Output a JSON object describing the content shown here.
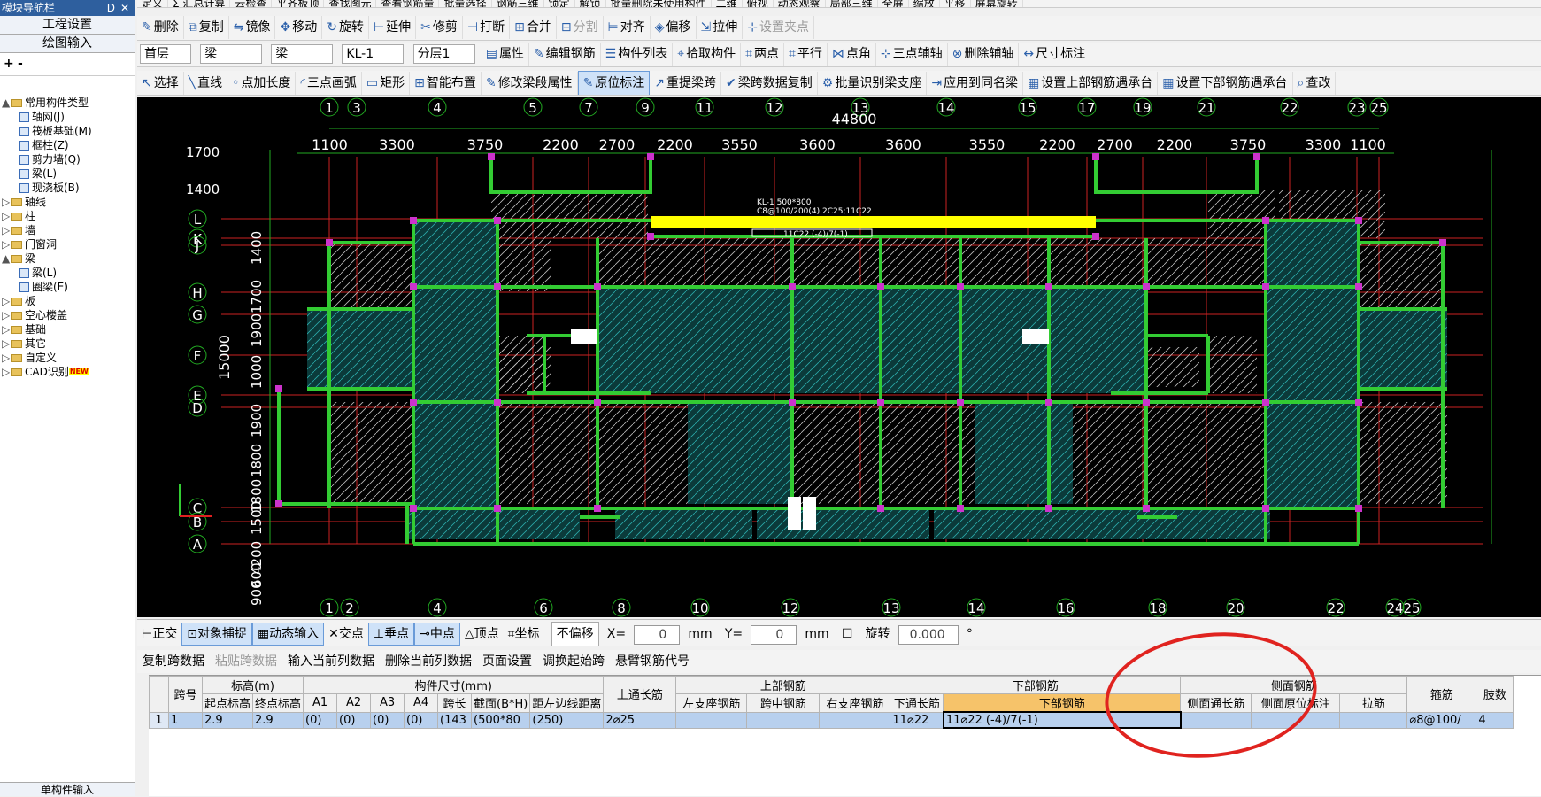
{
  "left_panel": {
    "title": "模块导航栏",
    "pin": "ᗞ",
    "close": "✕",
    "btn_project": "工程设置",
    "btn_draw": "绘图输入",
    "expand": "+",
    "collapse": "-",
    "tree": [
      {
        "label": "常用构件类型",
        "level": 0,
        "toggle": "▲"
      },
      {
        "label": "轴网(J)",
        "level": 1
      },
      {
        "label": "筏板基础(M)",
        "level": 1
      },
      {
        "label": "框柱(Z)",
        "level": 1
      },
      {
        "label": "剪力墙(Q)",
        "level": 1
      },
      {
        "label": "梁(L)",
        "level": 1
      },
      {
        "label": "现浇板(B)",
        "level": 1
      },
      {
        "label": "轴线",
        "level": 0,
        "toggle": "▷"
      },
      {
        "label": "柱",
        "level": 0,
        "toggle": "▷"
      },
      {
        "label": "墙",
        "level": 0,
        "toggle": "▷"
      },
      {
        "label": "门窗洞",
        "level": 0,
        "toggle": "▷"
      },
      {
        "label": "梁",
        "level": 0,
        "toggle": "▲"
      },
      {
        "label": "梁(L)",
        "level": 1
      },
      {
        "label": "圈梁(E)",
        "level": 1
      },
      {
        "label": "板",
        "level": 0,
        "toggle": "▷"
      },
      {
        "label": "空心楼盖",
        "level": 0,
        "toggle": "▷"
      },
      {
        "label": "基础",
        "level": 0,
        "toggle": "▷"
      },
      {
        "label": "其它",
        "level": 0,
        "toggle": "▷"
      },
      {
        "label": "自定义",
        "level": 0,
        "toggle": "▷"
      },
      {
        "label": "CAD识别",
        "level": 0,
        "toggle": "▷",
        "badge": "NEW"
      }
    ],
    "bottom": "单构件输入"
  },
  "toolbar_top": [
    "定义",
    "Σ 汇总计算",
    "云检查",
    "平齐板顶",
    "查找图元",
    "查看钢筋量",
    "批量选择",
    "钢筋三维",
    "锁定",
    "解锁",
    "批量删除未使用构件",
    "二维",
    "俯视",
    "动态观察",
    "局部三维",
    "全屏",
    "缩放",
    "平移",
    "屏幕旋转"
  ],
  "toolbar_edit": [
    {
      "g": "✎",
      "t": "删除"
    },
    {
      "g": "⧉",
      "t": "复制"
    },
    {
      "g": "⇋",
      "t": "镜像"
    },
    {
      "g": "✥",
      "t": "移动"
    },
    {
      "g": "↻",
      "t": "旋转"
    },
    {
      "g": "⊢",
      "t": "延伸"
    },
    {
      "g": "✂",
      "t": "修剪"
    },
    {
      "g": "⊣",
      "t": "打断"
    },
    {
      "g": "⊞",
      "t": "合并"
    },
    {
      "g": "⊟",
      "t": "分割",
      "dim": true
    },
    {
      "g": "⊨",
      "t": "对齐"
    },
    {
      "g": "◈",
      "t": "偏移"
    },
    {
      "g": "⇲",
      "t": "拉伸"
    },
    {
      "g": "⊹",
      "t": "设置夹点",
      "dim": true
    }
  ],
  "toolbar_component": {
    "floor": "首层",
    "type": "梁",
    "subtype": "梁",
    "name": "KL-1",
    "layer": "分层1",
    "items": [
      {
        "g": "▤",
        "t": "属性"
      },
      {
        "g": "✎",
        "t": "编辑钢筋"
      },
      {
        "g": "☰",
        "t": "构件列表"
      },
      {
        "g": "⌖",
        "t": "拾取构件"
      },
      {
        "g": "⌗",
        "t": "两点"
      },
      {
        "g": "⌗",
        "t": "平行"
      },
      {
        "g": "⋈",
        "t": "点角"
      },
      {
        "g": "⊹",
        "t": "三点辅轴"
      },
      {
        "g": "⊗",
        "t": "删除辅轴"
      },
      {
        "g": "↔",
        "t": "尺寸标注"
      }
    ]
  },
  "toolbar_draw": [
    {
      "g": "↖",
      "t": "选择"
    },
    {
      "g": "╲",
      "t": "直线"
    },
    {
      "g": "◦",
      "t": "点加长度"
    },
    {
      "g": "◜",
      "t": "三点画弧"
    },
    {
      "g": "▭",
      "t": "矩形"
    },
    {
      "g": "⊞",
      "t": "智能布置"
    },
    {
      "g": "✎",
      "t": "修改梁段属性"
    },
    {
      "g": "✎",
      "t": "原位标注",
      "active": true
    },
    {
      "g": "↗",
      "t": "重提梁跨"
    },
    {
      "g": "✔",
      "t": "梁跨数据复制"
    },
    {
      "g": "⚙",
      "t": "批量识别梁支座"
    },
    {
      "g": "⇥",
      "t": "应用到同名梁"
    },
    {
      "g": "▦",
      "t": "设置上部钢筋遇承台"
    },
    {
      "g": "▦",
      "t": "设置下部钢筋遇承台"
    },
    {
      "g": "⌕",
      "t": "查改"
    }
  ],
  "canvas": {
    "axes_top": [
      "1",
      "3",
      "4",
      "5",
      "7",
      "9",
      "11",
      "12",
      "13",
      "14",
      "15",
      "17",
      "19",
      "21",
      "22",
      "23",
      "25"
    ],
    "axes_bottom": [
      "1",
      "2",
      "4",
      "6",
      "8",
      "10",
      "12",
      "13",
      "14",
      "16",
      "18",
      "20",
      "22",
      "24",
      "25"
    ],
    "axes_left": [
      "L",
      "K",
      "J",
      "H",
      "G",
      "F",
      "E",
      "D",
      "C",
      "B",
      "A"
    ],
    "total_width": "44800",
    "dims_top": [
      "1100",
      "3300",
      "3750",
      "2200",
      "2700",
      "2200",
      "3550",
      "3600",
      "3600",
      "3550",
      "2200",
      "2700",
      "2200",
      "3750",
      "3300",
      "1100"
    ],
    "dims_left": [
      "1700",
      "1400",
      "1400",
      "1700",
      "1900",
      "1000",
      "1900",
      "1800",
      "1800",
      "1500",
      "4200",
      "600",
      "900"
    ],
    "left_total": "15000",
    "beam_label_1": "KL-1 500*800",
    "beam_label_2": "C8@100/200(4) 2C25;11C22",
    "beam_label_3": "11C22 (-4)/7(-1)",
    "colors": {
      "beam_green": "#33cc33",
      "selected": "#ffff00",
      "column": "#cc33cc",
      "grid": "#cc2222",
      "dim": "#22aa22"
    }
  },
  "snapbar": {
    "items": [
      {
        "g": "⊢",
        "t": "正交"
      },
      {
        "g": "⊡",
        "t": "对象捕捉",
        "active": true
      },
      {
        "g": "▦",
        "t": "动态输入",
        "active": true
      },
      {
        "g": "✕",
        "t": "交点"
      },
      {
        "g": "⊥",
        "t": "垂点",
        "active": true
      },
      {
        "g": "⊸",
        "t": "中点",
        "active": true
      },
      {
        "g": "△",
        "t": "顶点"
      },
      {
        "g": "⌗",
        "t": "坐标"
      }
    ],
    "offset_mode": "不偏移",
    "x_label": "X=",
    "x_value": "0",
    "unit": "mm",
    "y_label": "Y=",
    "y_value": "0",
    "rotate_label": "旋转",
    "rotate_value": "0.000",
    "deg": "°"
  },
  "table_toolbar": [
    {
      "t": "复制跨数据"
    },
    {
      "t": "粘贴跨数据",
      "dim": true
    },
    {
      "t": "输入当前列数据"
    },
    {
      "t": "删除当前列数据"
    },
    {
      "t": "页面设置"
    },
    {
      "t": "调换起始跨"
    },
    {
      "t": "悬臂钢筋代号"
    }
  ],
  "table": {
    "group_headers": {
      "span": "跨号",
      "elev": "标高(m)",
      "size": "构件尺寸(mm)",
      "top_through": "上通长筋",
      "top_bar": "上部钢筋",
      "bottom_bar": "下部钢筋",
      "side_bar": "侧面钢筋",
      "stirrup": "箍筋",
      "legs": "肢数"
    },
    "sub_headers": {
      "start": "起点标高",
      "end": "终点标高",
      "a1": "A1",
      "a2": "A2",
      "a3": "A3",
      "a4": "A4",
      "span_len": "跨长",
      "section": "截面(B*H)",
      "edge": "距左边线距离",
      "left_seat": "左支座钢筋",
      "mid": "跨中钢筋",
      "right_seat": "右支座钢筋",
      "bottom_through": "下通长筋",
      "bottom": "下部钢筋",
      "side_through": "侧面通长筋",
      "side_in": "侧面原位标注",
      "tie": "拉筋"
    },
    "row": {
      "idx": "1",
      "span": "1",
      "start": "2.9",
      "end": "2.9",
      "a1": "(0)",
      "a2": "(0)",
      "a3": "(0)",
      "a4": "(0)",
      "span_len": "(143",
      "section": "(500*80",
      "edge": "(250)",
      "top_through": "2⌀25",
      "left_seat": "",
      "mid": "",
      "right_seat": "",
      "bottom_through": "11⌀22",
      "bottom": "11⌀22 (-4)/7(-1)",
      "side_through": "",
      "side_in": "",
      "tie": "",
      "stirrup": "⌀8@100/",
      "legs": "4"
    }
  }
}
